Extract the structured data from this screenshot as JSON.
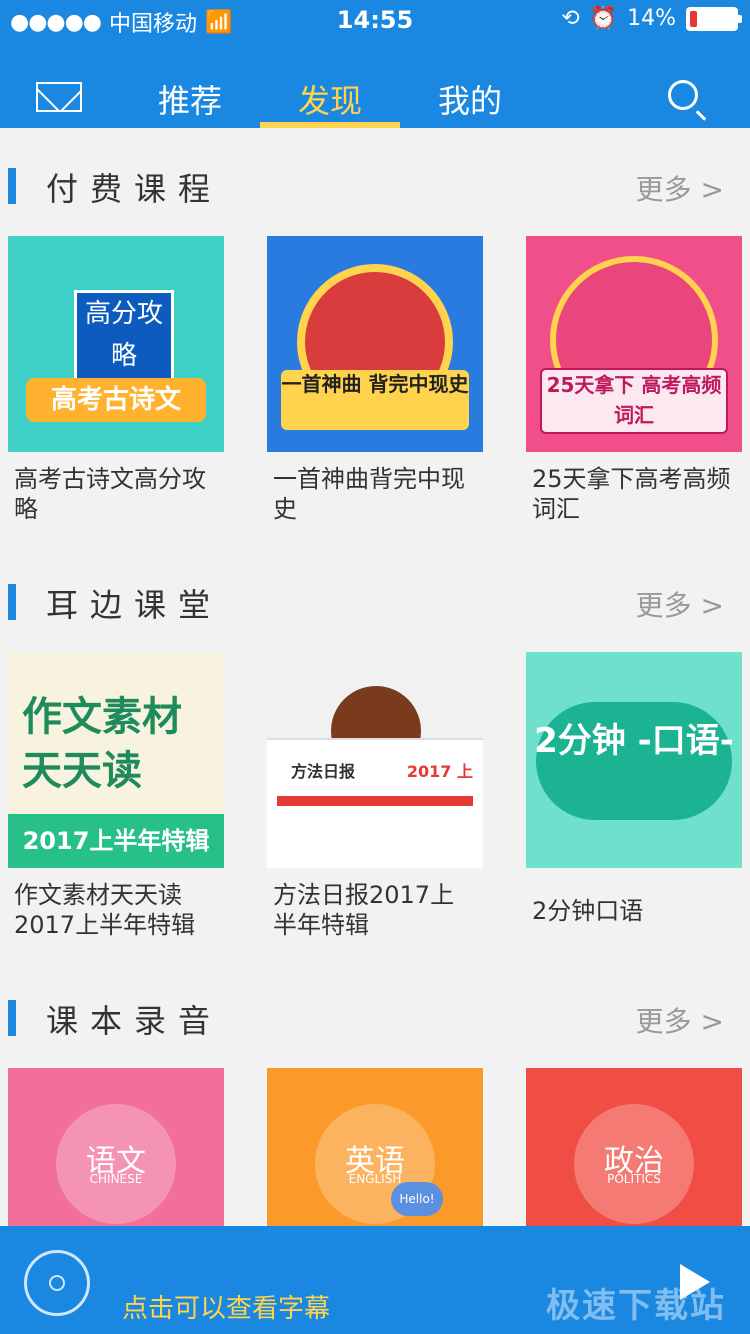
{
  "status": {
    "carrier": "中国移动",
    "time": "14:55",
    "battery": "14%",
    "battery_level": 0.14
  },
  "nav": {
    "tabs": [
      "推荐",
      "发现",
      "我的"
    ],
    "active_tab": "发现"
  },
  "sections": [
    {
      "title": "付费课程",
      "more": "更多 >",
      "items": [
        {
          "title": "高考古诗文高分攻略",
          "thumb_badge": "高考古诗文",
          "thumb_book": "高分攻略"
        },
        {
          "title": "一首神曲背完中现史",
          "thumb_ribbon": "一首神曲 背完中现史"
        },
        {
          "title": "25天拿下高考高频词汇",
          "thumb_ribbon": "25天拿下 高考高频词汇"
        }
      ]
    },
    {
      "title": "耳边课堂",
      "more": "更多 >",
      "items": [
        {
          "title": "作文素材天天读2017上半年特辑",
          "thumb_main": "作文素材 天天读",
          "thumb_band": "2017上半年特辑"
        },
        {
          "title": "方法日报2017上半年特辑",
          "thumb_left": "方法日报",
          "thumb_right": "2017 上"
        },
        {
          "title": "2分钟口语",
          "thumb_main": "2分钟 -口语-"
        }
      ]
    },
    {
      "title": "课本录音",
      "more": "更多 >",
      "items": [
        {
          "cn": "语文",
          "en": "CHINESE"
        },
        {
          "cn": "英语",
          "en": "ENGLISH",
          "bubble": "Hello!"
        },
        {
          "cn": "政治",
          "en": "POLITICS"
        }
      ]
    }
  ],
  "player": {
    "subtitle_hint": "点击可以查看字幕",
    "watermark": "极速下载站"
  }
}
